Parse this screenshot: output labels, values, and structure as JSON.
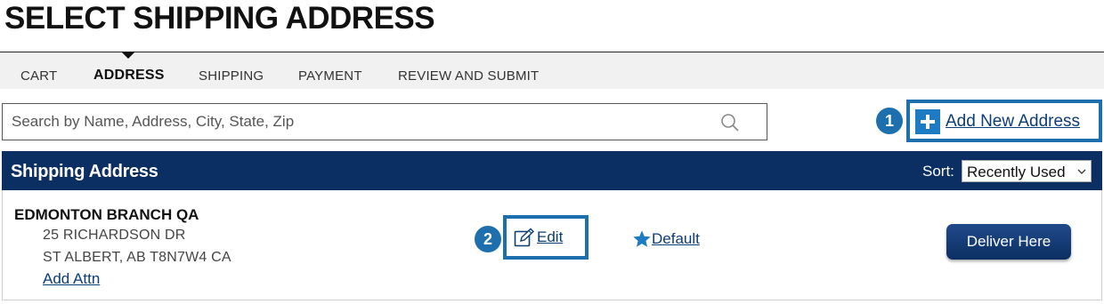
{
  "page": {
    "title": "SELECT SHIPPING ADDRESS"
  },
  "steps": [
    {
      "label": "CART",
      "active": false
    },
    {
      "label": "ADDRESS",
      "active": true
    },
    {
      "label": "SHIPPING",
      "active": false
    },
    {
      "label": "PAYMENT",
      "active": false
    },
    {
      "label": "REVIEW AND SUBMIT",
      "active": false
    }
  ],
  "search": {
    "placeholder": "Search by Name, Address, City, State, Zip",
    "value": "",
    "icon": "search-icon"
  },
  "actions": {
    "add_new_address": "Add New Address",
    "add_icon": "plus-icon"
  },
  "callouts": {
    "one": "1",
    "two": "2"
  },
  "panel": {
    "title": "Shipping Address",
    "sort_label": "Sort:",
    "sort_value": "Recently Used"
  },
  "address": {
    "name": "EDMONTON BRANCH QA",
    "line1": "25 RICHARDSON DR",
    "line2": "ST ALBERT, AB T8N7W4 CA",
    "add_attn": "Add Attn",
    "edit": "Edit",
    "default": "Default",
    "deliver": "Deliver Here"
  },
  "colors": {
    "navy": "#0c2f63",
    "highlight": "#1d6fae",
    "link": "#0b3d77"
  }
}
